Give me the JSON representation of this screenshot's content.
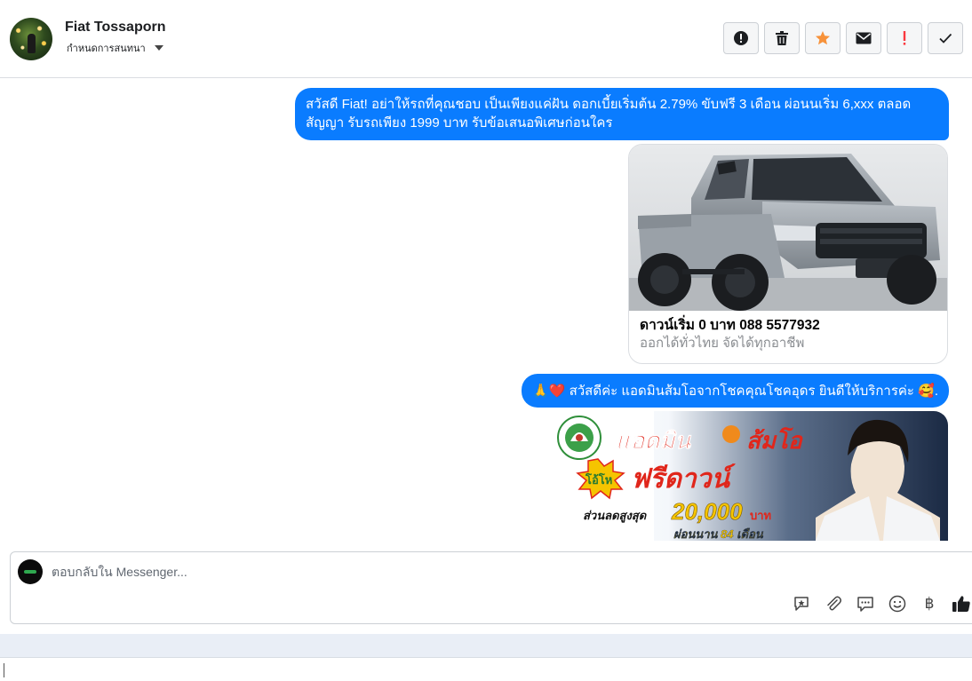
{
  "header": {
    "contact_name": "Fiat Tossaporn",
    "assign_label": "กำหนดการสนทนา",
    "toolbar": [
      {
        "name": "report-spam-button",
        "icon": "alert-circle-icon"
      },
      {
        "name": "delete-button",
        "icon": "trash-icon"
      },
      {
        "name": "star-button",
        "icon": "star-icon",
        "color": "#f7923a"
      },
      {
        "name": "mark-unread-button",
        "icon": "envelope-icon"
      },
      {
        "name": "follow-up-button",
        "icon": "exclamation-icon",
        "color": "#fa383e"
      },
      {
        "name": "mark-done-button",
        "icon": "checkmark-icon"
      }
    ]
  },
  "messages": {
    "msg1": "สวัสดี Fiat! อย่าให้รถที่คุณชอบ เป็นเพียงแค่ฝัน ดอกเบี้ยเริ่มต้น 2.79% ขับฟรี 3 เดือน ผ่อนนเริ่ม 6,xxx ตลอดสัญญา รับรถเพียง 1999 บาท รับข้อเสนอพิเศษก่อนใคร",
    "card": {
      "title": "ดาวน์เริ่ม 0 บาท 088 5577932",
      "subtitle": "ออกได้ทั่วไทย จัดได้ทุกอาชีพ"
    },
    "msg2": "🙏❤️ สวัสดีค่ะ แอดมินส้มโอจากโชคคุณโชคอุดร ยินดีให้บริการค่ะ 🥰.",
    "promo": {
      "headline": "แอดมิน",
      "headline2": "ส้มโอ",
      "badge": "โอ้โห",
      "offer": "ฟรีดาวน์",
      "discount_label": "ส่วนลดสูงสุด",
      "discount_amount": "20,000",
      "discount_unit": "บาท",
      "installment": "ผ่อนนาน 84 เดือน"
    }
  },
  "reply": {
    "placeholder": "ตอบกลับใน Messenger..."
  },
  "colors": {
    "bubble": "#0a7cff",
    "accent_star": "#f7923a",
    "alert_red": "#fa383e"
  }
}
